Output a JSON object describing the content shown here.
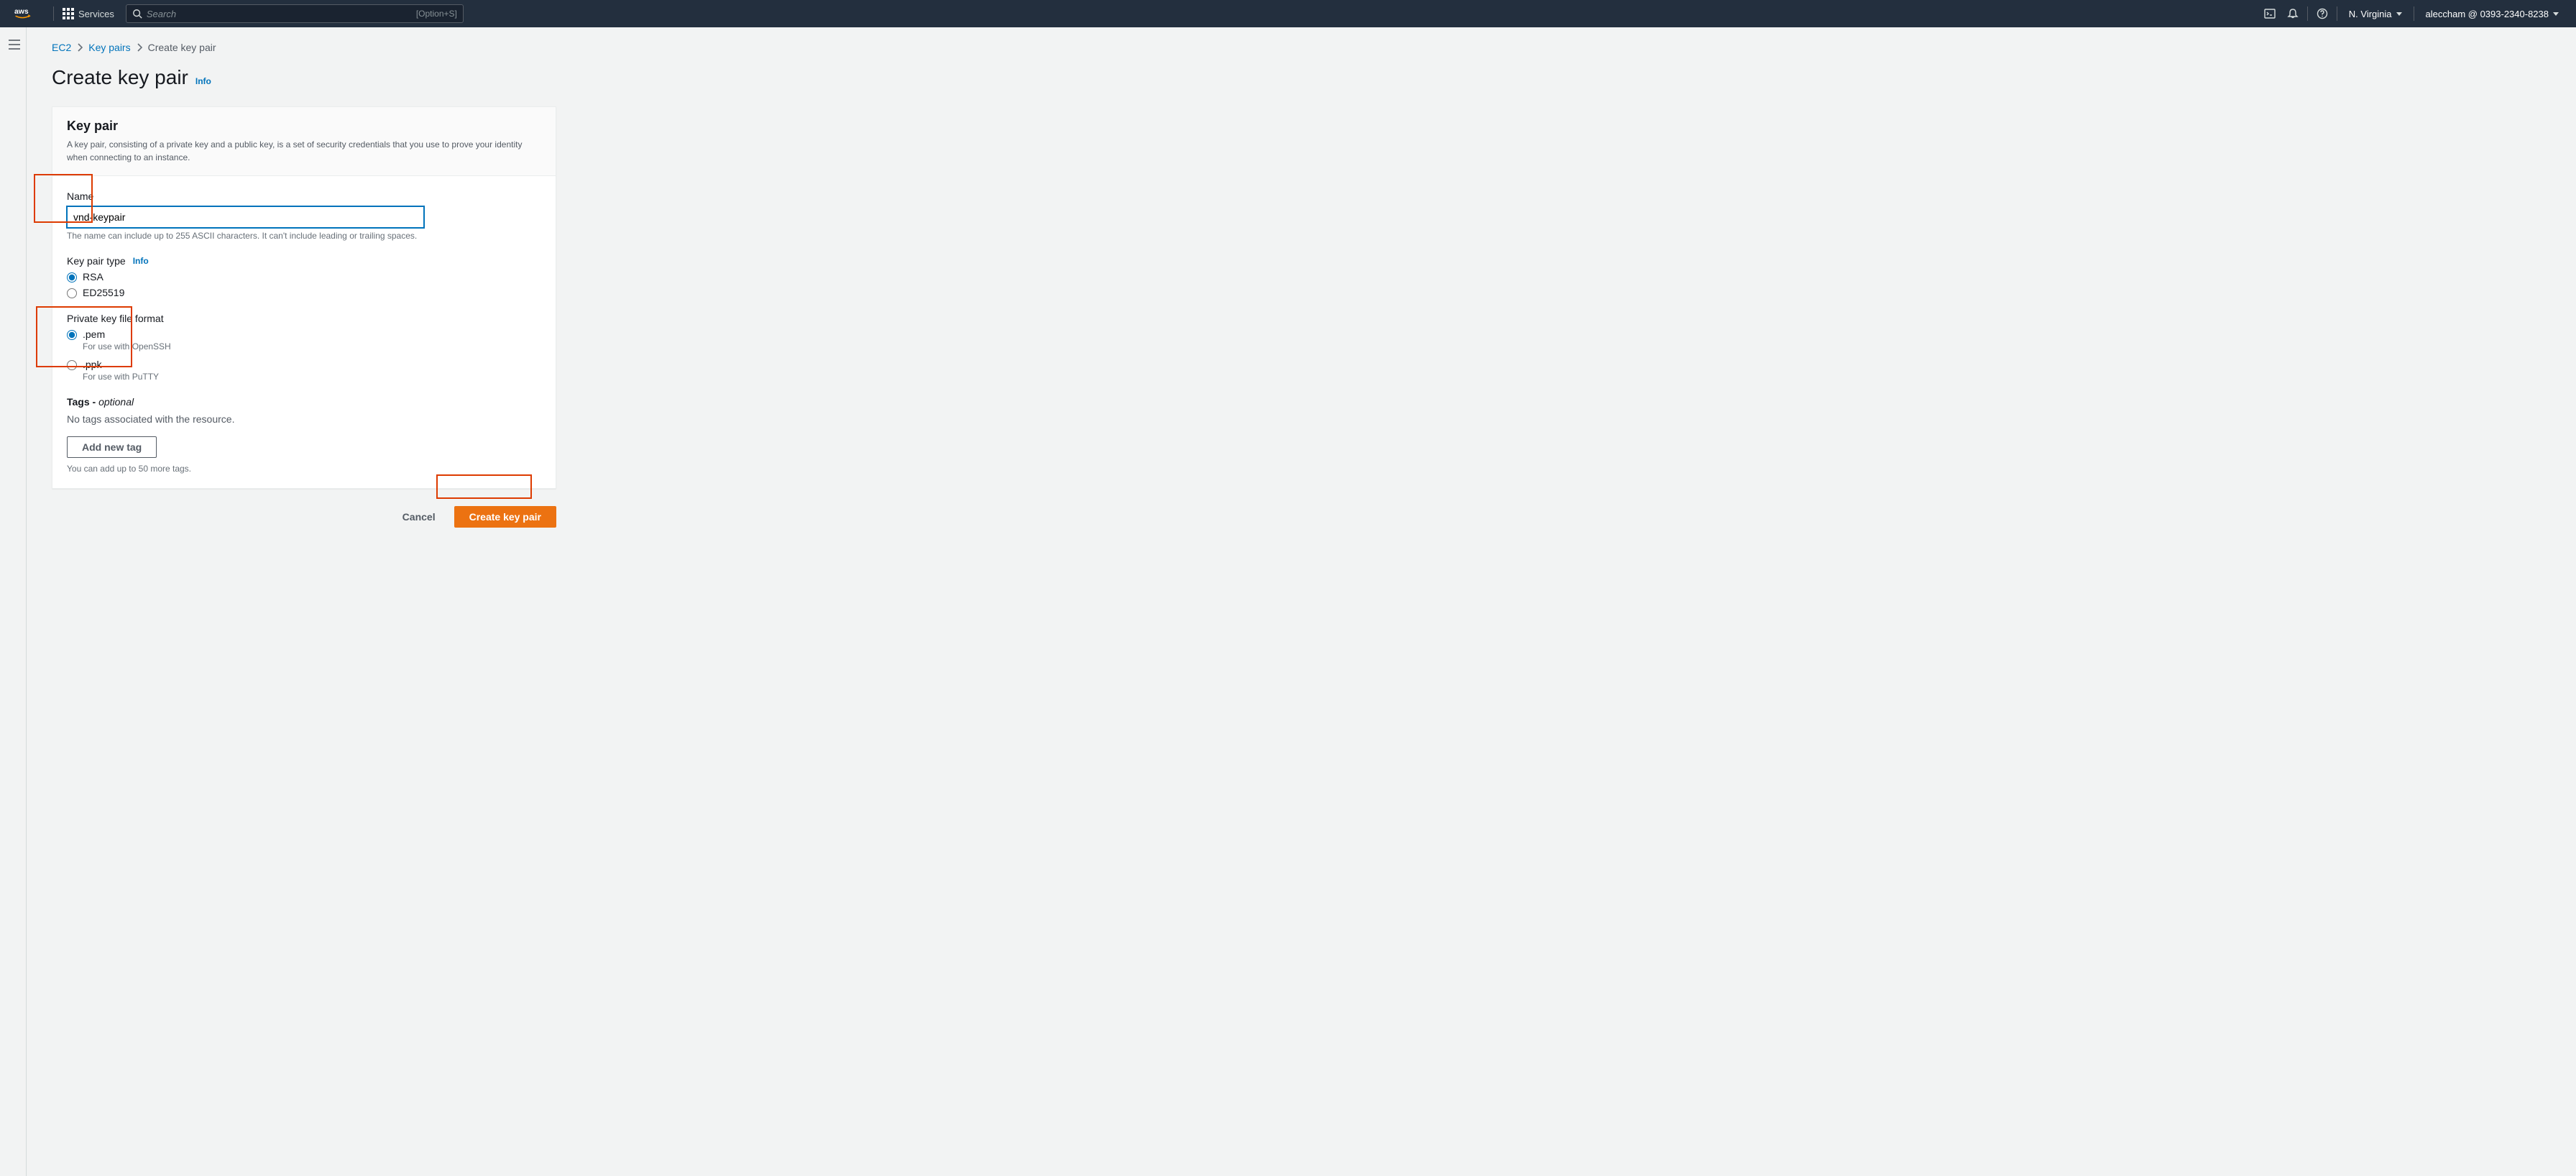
{
  "nav": {
    "services_label": "Services",
    "search_placeholder": "Search",
    "search_shortcut": "[Option+S]",
    "region": "N. Virginia",
    "account": "aleccham @ 0393-2340-8238"
  },
  "breadcrumbs": {
    "ec2": "EC2",
    "keypairs": "Key pairs",
    "current": "Create key pair"
  },
  "page": {
    "title": "Create key pair",
    "info": "Info"
  },
  "panel": {
    "header": {
      "title": "Key pair",
      "description": "A key pair, consisting of a private key and a public key, is a set of security credentials that you use to prove your identity when connecting to an instance."
    },
    "name": {
      "label": "Name",
      "value": "vnd-keypair",
      "hint": "The name can include up to 255 ASCII characters. It can't include leading or trailing spaces."
    },
    "keytype": {
      "label": "Key pair type",
      "info": "Info",
      "options": {
        "rsa": "RSA",
        "ed25519": "ED25519"
      }
    },
    "format": {
      "label": "Private key file format",
      "pem": {
        "label": ".pem",
        "sub": "For use with OpenSSH"
      },
      "ppk": {
        "label": ".ppk",
        "sub": "For use with PuTTY"
      }
    },
    "tags": {
      "title": "Tags - ",
      "optional": "optional",
      "empty": "No tags associated with the resource.",
      "add_btn": "Add new tag",
      "limit": "You can add up to 50 more tags."
    }
  },
  "actions": {
    "cancel": "Cancel",
    "create": "Create key pair"
  }
}
